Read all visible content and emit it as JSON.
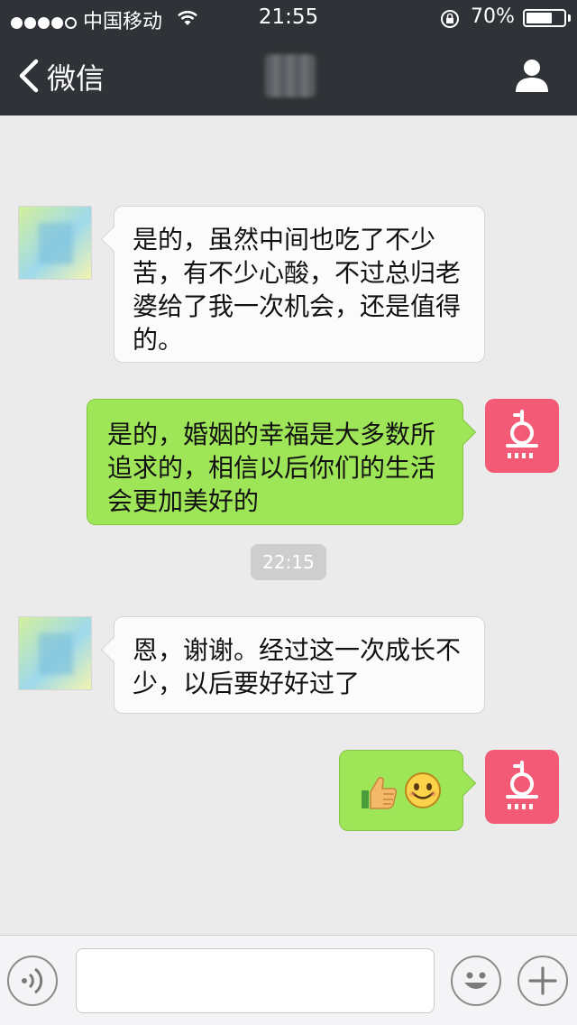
{
  "status_bar": {
    "signal_dots_filled": 4,
    "signal_dots_total": 5,
    "carrier": "中国移动",
    "time": "21:55",
    "battery_percent": "70%",
    "battery_level": 0.7
  },
  "nav": {
    "back_label": "微信"
  },
  "chat": {
    "messages": [
      {
        "direction": "in",
        "text": "是的，虽然中间也吃了不少苦，有不少心酸，不过总归老婆给了我一次机会，还是值得的。"
      },
      {
        "direction": "out",
        "text": "是的，婚姻的幸福是大多数所追求的，相信以后你们的生活会更加美好的"
      },
      {
        "direction": "in",
        "text": "恩，谢谢。经过这一次成长不少，以后要好好过了"
      },
      {
        "direction": "out",
        "emoji": [
          "thumbs-up",
          "smile"
        ]
      }
    ],
    "timestamp": "22:15"
  },
  "colors": {
    "topbar": "#2f3236",
    "chat_background": "#ebebeb",
    "outgoing_bubble": "#9fe558",
    "incoming_bubble": "#fbfbfb",
    "self_avatar": "#f25a75"
  },
  "input_bar": {
    "value": "",
    "voice_icon": "voice-icon",
    "emoji_icon": "emoji-icon",
    "plus_icon": "plus-icon"
  }
}
